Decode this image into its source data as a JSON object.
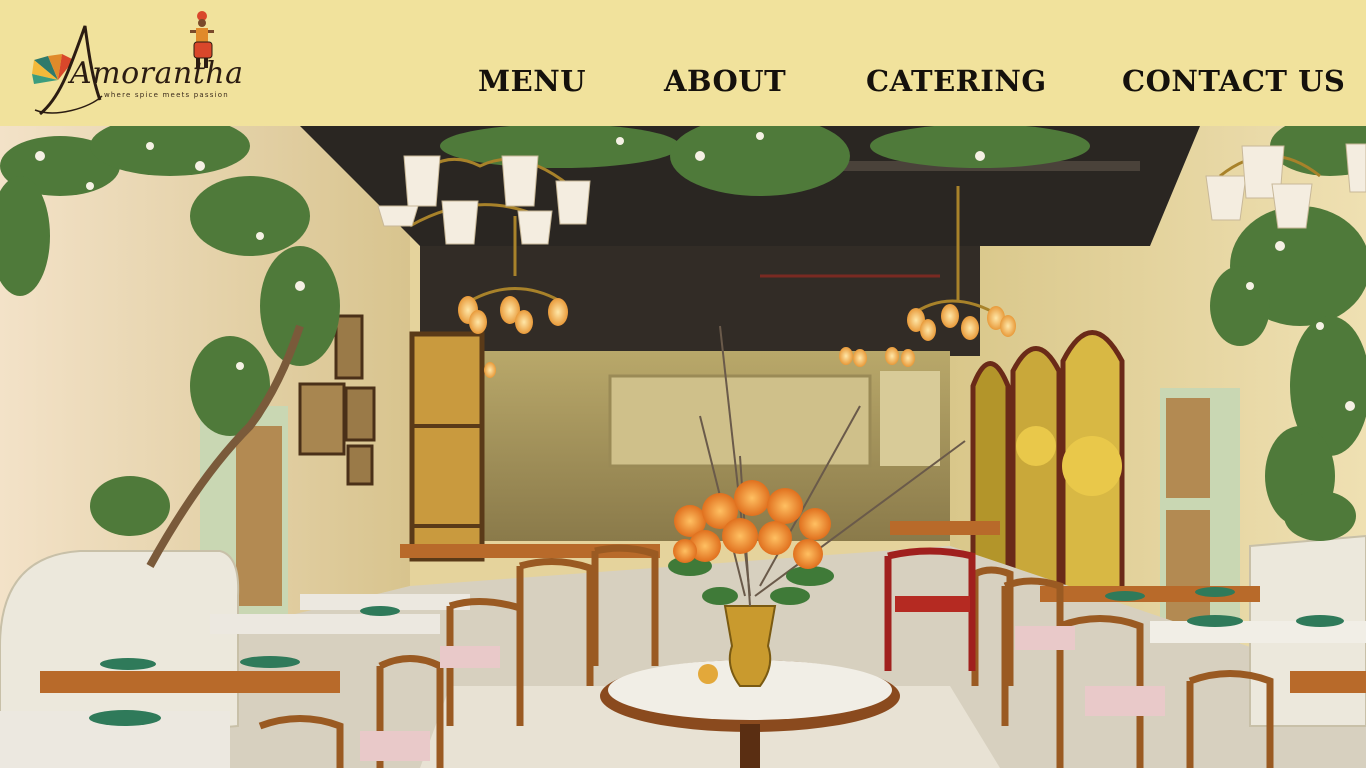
{
  "brand": {
    "name": "Amorantha",
    "tagline": "where spice meets passion"
  },
  "nav": {
    "items": [
      {
        "label": "MENU"
      },
      {
        "label": "ABOUT"
      },
      {
        "label": "CATERING"
      },
      {
        "label": "CONTACT US"
      }
    ]
  },
  "colors": {
    "header_background": "#f1e29c",
    "nav_text": "#15110c"
  },
  "hero": {
    "image": "restaurant-interior-photo"
  }
}
